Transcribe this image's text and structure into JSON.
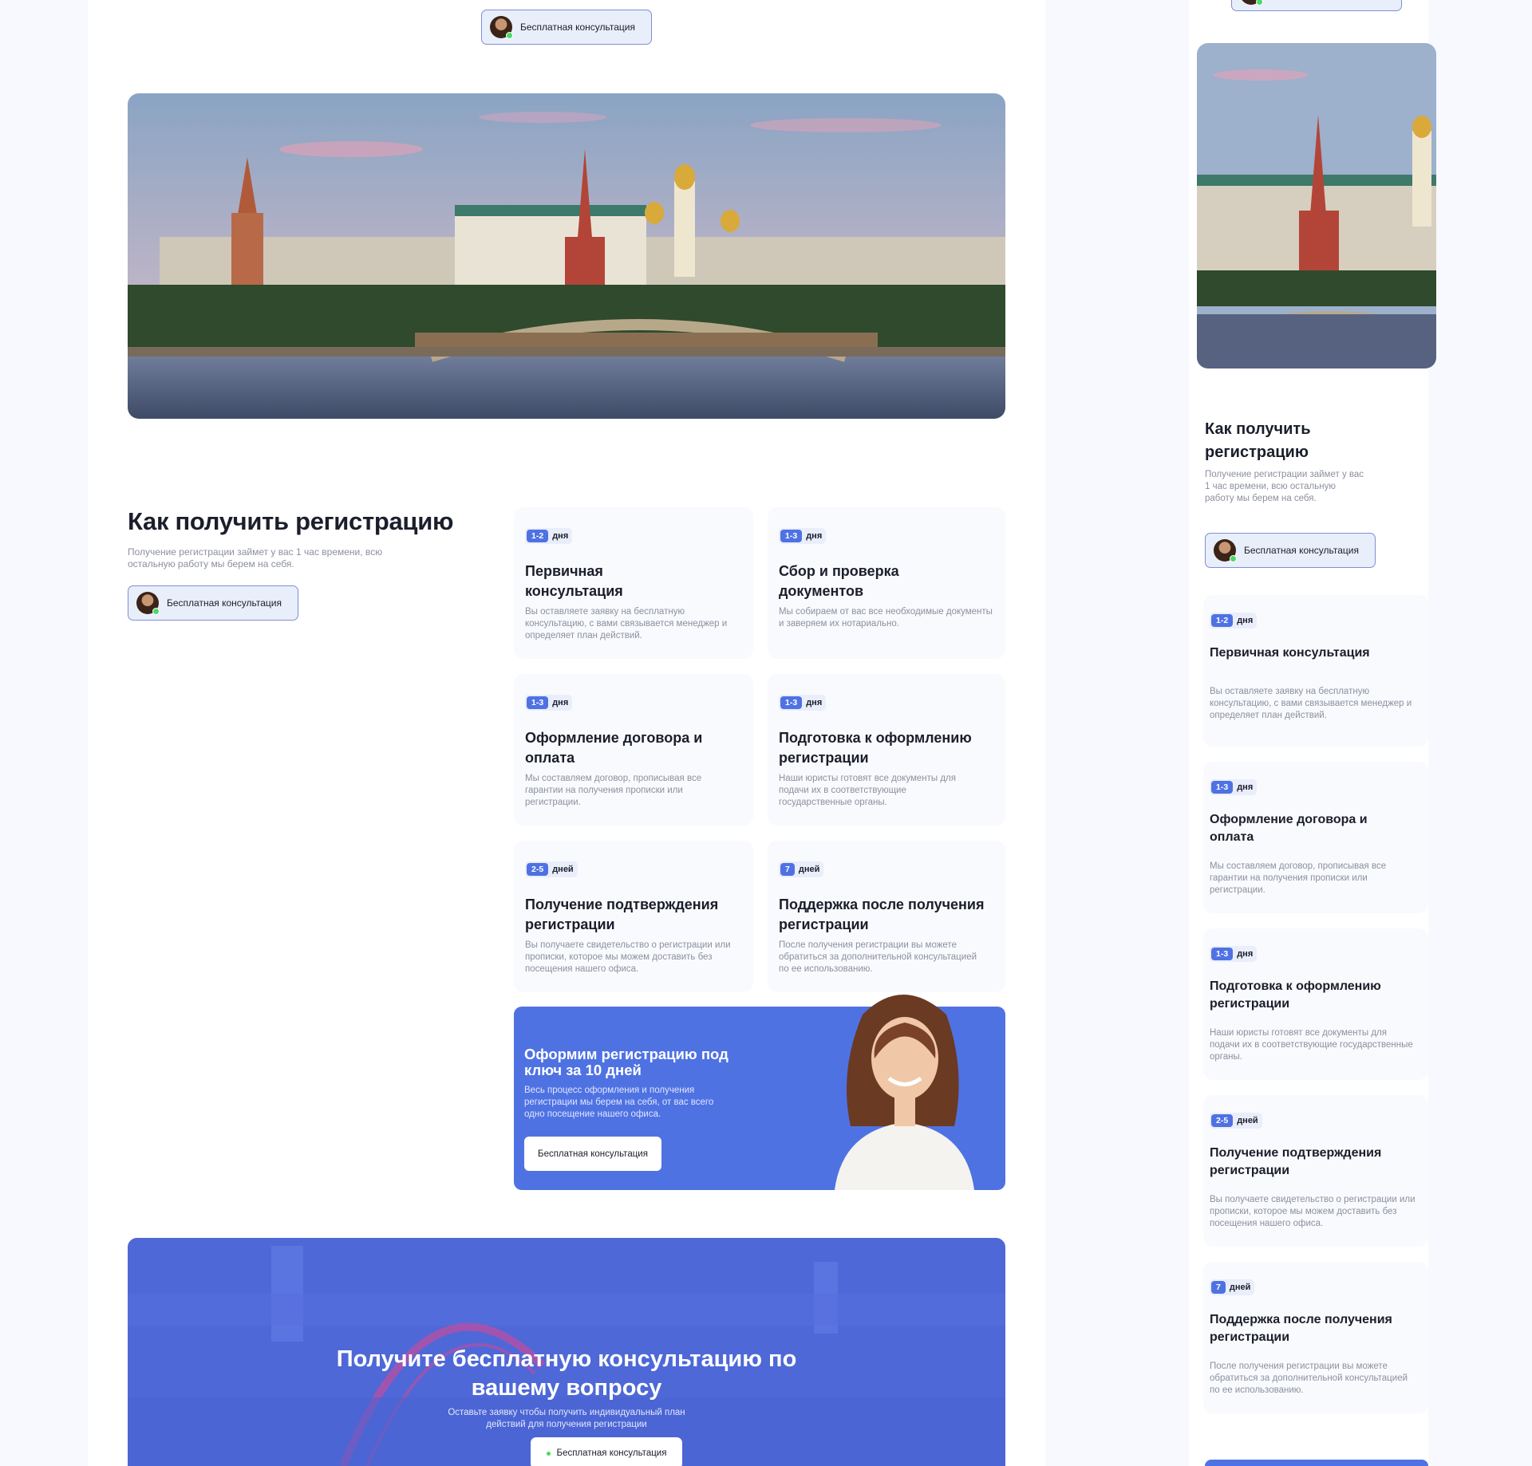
{
  "consult_label": "Бесплатная консультация",
  "section": {
    "title": "Как получить регистрацию",
    "subtitle": "Получение регистрации займет у вас 1 час времени, всю остальную работу мы берем на себя."
  },
  "steps": [
    {
      "num": "1-2",
      "unit": "дня",
      "title": "Первичная консультация",
      "text": "Вы оставляете заявку на бесплатную консультацию, с вами связывается менеджер и определяет план действий."
    },
    {
      "num": "1-3",
      "unit": "дня",
      "title": "Сбор и проверка документов",
      "text": "Мы собираем от вас все необходимые документы и заверяем их нотариально."
    },
    {
      "num": "1-3",
      "unit": "дня",
      "title": "Оформление договора и оплата",
      "text": "Мы составляем договор, прописывая все гарантии на получения прописки или регистрации."
    },
    {
      "num": "1-3",
      "unit": "дня",
      "title": "Подготовка к оформлению регистрации",
      "text": "Наши юристы готовят все документы для подачи их в соответствующие государственные органы."
    },
    {
      "num": "2-5",
      "unit": "дней",
      "title": "Получение подтверждения регистрации",
      "text": "Вы получаете свидетельство о регистрации или прописки, которое мы можем доставить без посещения нашего офиса."
    },
    {
      "num": "7",
      "unit": "дней",
      "title": "Поддержка после получения регистрации",
      "text": "После получения регистрации вы можете обратиться за дополнительной консультацией по ее использованию."
    }
  ],
  "promo": {
    "title": "Оформим регистрацию под ключ за 10 дней",
    "text": "Весь процесс оформления и получения регистрации мы берем на себя, от вас всего одно посещение нашего офиса.",
    "button": "Бесплатная консультация"
  },
  "cta": {
    "title": "Получите бесплатную консультацию по вашему вопросу",
    "text": "Оставьте заявку чтобы получить индивидуальный план действий для получения регистрации",
    "button": "Бесплатная консультация"
  },
  "colors": {
    "accent": "#4f72e3",
    "badge_bg": "#eaeefb",
    "muted": "#8c90a0"
  },
  "icons": [
    "avatar",
    "online-dot-icon"
  ]
}
